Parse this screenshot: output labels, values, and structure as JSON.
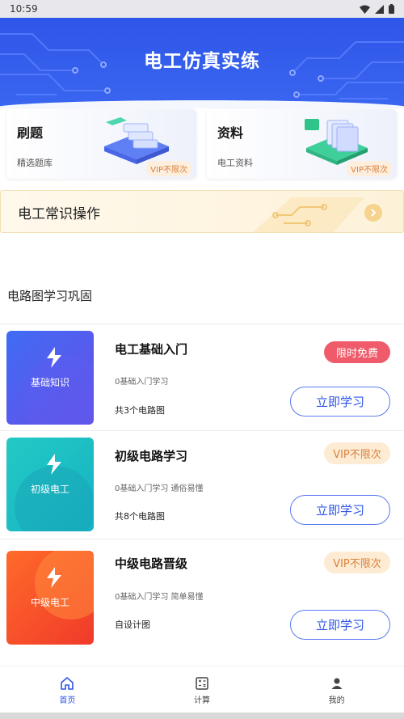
{
  "status_bar": {
    "time": "10:59"
  },
  "header": {
    "title": "电工仿真实练"
  },
  "cards": [
    {
      "title": "刷题",
      "subtitle": "精选题库",
      "badge": "VIP不限次"
    },
    {
      "title": "资料",
      "subtitle": "电工资料",
      "badge": "VIP不限次"
    }
  ],
  "banner": {
    "title": "电工常识操作"
  },
  "section": {
    "title": "电路图学习巩固"
  },
  "courses": [
    {
      "thumb_label": "基础知识",
      "title": "电工基础入门",
      "tag": "限时免费",
      "desc": "0基础入门学习",
      "count": "共3个电路图",
      "button": "立即学习"
    },
    {
      "thumb_label": "初级电工",
      "title": "初级电路学习",
      "tag": "VIP不限次",
      "desc": "0基础入门学习 通俗易懂",
      "count": "共8个电路图",
      "button": "立即学习"
    },
    {
      "thumb_label": "中级电工",
      "title": "中级电路晋级",
      "tag": "VIP不限次",
      "desc": "0基础入门学习 简单易懂",
      "count": "自设计图",
      "button": "立即学习"
    }
  ],
  "tabbar": [
    {
      "label": "首页",
      "icon": "home-icon",
      "active": true
    },
    {
      "label": "计算",
      "icon": "calculator-icon",
      "active": false
    },
    {
      "label": "我的",
      "icon": "user-icon",
      "active": false
    }
  ],
  "colors": {
    "primary": "#2e55e8",
    "free_tag": "#ef5b6a",
    "vip_text": "#d9823c",
    "vip_bg": "#fdebd3"
  }
}
